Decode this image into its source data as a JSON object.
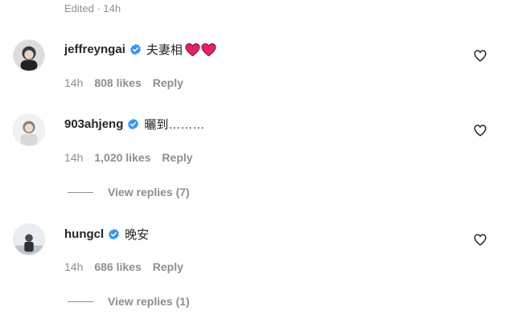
{
  "top": {
    "edited_label": "Edited · 14h"
  },
  "comments": [
    {
      "username": "jeffreyngai",
      "text": "夫妻相",
      "time": "14h",
      "likes": "808 likes",
      "reply_label": "Reply",
      "has_hearts": true
    },
    {
      "username": "903ahjeng",
      "text": "曬到………",
      "time": "14h",
      "likes": "1,020 likes",
      "reply_label": "Reply",
      "view_replies": "View replies (7)"
    },
    {
      "username": "hungcl",
      "text": "晚安",
      "time": "14h",
      "likes": "686 likes",
      "reply_label": "Reply",
      "view_replies": "View replies (1)"
    }
  ],
  "icons": {
    "verified": "verified-badge-icon",
    "like": "heart-outline-icon",
    "emoji": "red-heart-emoji"
  },
  "colors": {
    "verified_blue": "#3797f0",
    "heart_red": "#e0245e",
    "meta_gray": "#8e8e8e",
    "text_dark": "#262626"
  }
}
